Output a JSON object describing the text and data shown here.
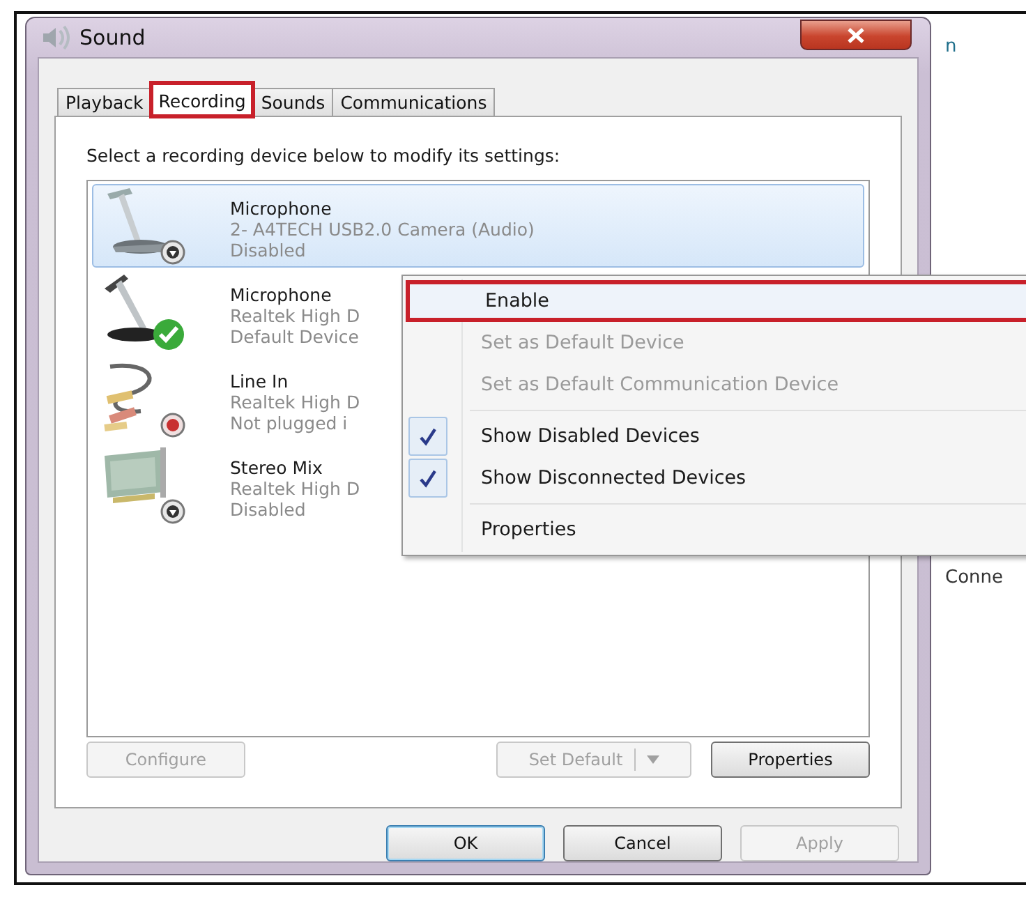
{
  "window": {
    "title": "Sound"
  },
  "tabs": [
    {
      "label": "Playback",
      "selected": false,
      "outlined": false
    },
    {
      "label": "Recording",
      "selected": true,
      "outlined": true
    },
    {
      "label": "Sounds",
      "selected": false,
      "outlined": false
    },
    {
      "label": "Communications",
      "selected": false,
      "outlined": false
    }
  ],
  "instruction": "Select a recording device below to modify its settings:",
  "devices": [
    {
      "name": "Microphone",
      "description": "2- A4TECH USB2.0 Camera (Audio)",
      "status": "Disabled",
      "kind": "usb-mic",
      "disabled": true,
      "default_device": false,
      "unplugged": false,
      "selected": true
    },
    {
      "name": "Microphone",
      "description": "Realtek High D",
      "status": "Default Device",
      "kind": "desk-mic",
      "disabled": false,
      "default_device": true,
      "unplugged": false,
      "selected": false
    },
    {
      "name": "Line In",
      "description": "Realtek High D",
      "status": "Not plugged i",
      "kind": "line-in",
      "disabled": false,
      "default_device": false,
      "unplugged": true,
      "selected": false
    },
    {
      "name": "Stereo Mix",
      "description": "Realtek High D",
      "status": "Disabled",
      "kind": "card",
      "disabled": true,
      "default_device": false,
      "unplugged": false,
      "selected": false
    }
  ],
  "panel_buttons": [
    {
      "label": "Configure",
      "kind": "button",
      "disabled": true
    },
    {
      "label": "Set Default",
      "kind": "split",
      "disabled": true
    },
    {
      "label": "Properties",
      "kind": "button",
      "disabled": false
    }
  ],
  "dialog_buttons": [
    {
      "label": "OK",
      "disabled": false,
      "default": true
    },
    {
      "label": "Cancel",
      "disabled": false,
      "default": false
    },
    {
      "label": "Apply",
      "disabled": true,
      "default": false
    }
  ],
  "context_menu": {
    "items": [
      {
        "kind": "item",
        "label": "Enable",
        "disabled": false,
        "checked": false,
        "outlined": true
      },
      {
        "kind": "item",
        "label": "Set as Default Device",
        "disabled": true,
        "checked": false,
        "outlined": false
      },
      {
        "kind": "item",
        "label": "Set as Default Communication Device",
        "disabled": true,
        "checked": false,
        "outlined": false
      },
      {
        "kind": "separator"
      },
      {
        "kind": "item",
        "label": "Show Disabled Devices",
        "disabled": false,
        "checked": true,
        "outlined": false
      },
      {
        "kind": "item",
        "label": "Show Disconnected Devices",
        "disabled": false,
        "checked": true,
        "outlined": false
      },
      {
        "kind": "separator"
      },
      {
        "kind": "item",
        "label": "Properties",
        "disabled": false,
        "checked": false,
        "outlined": false
      }
    ]
  },
  "background_texts": [
    "n",
    "Conne"
  ]
}
